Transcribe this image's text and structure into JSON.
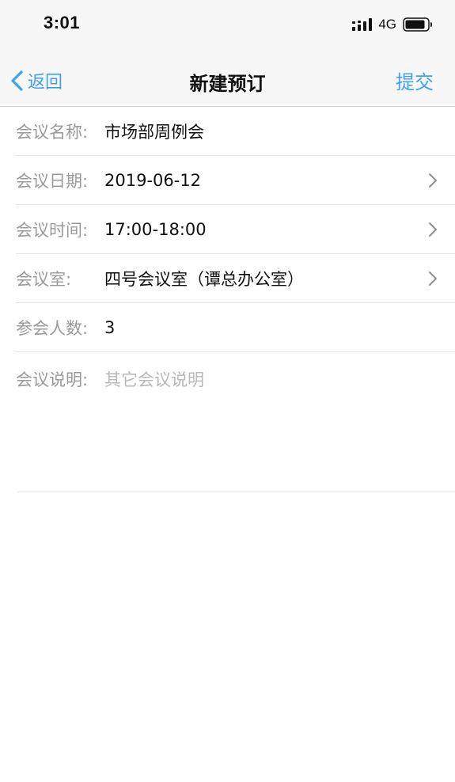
{
  "status_bar": {
    "time": "3:01",
    "network": "4G",
    "signal_icon": "signal-bars-icon",
    "battery_icon": "battery-icon"
  },
  "nav": {
    "back_label": "返回",
    "title": "新建预订",
    "submit_label": "提交",
    "accent_color": "#3fa0f0"
  },
  "form": {
    "rows": [
      {
        "label": "会议名称:",
        "value": "市场部周例会",
        "has_chevron": false
      },
      {
        "label": "会议日期:",
        "value": "2019-06-12",
        "has_chevron": true
      },
      {
        "label": "会议时间:",
        "value": "17:00-18:00",
        "has_chevron": true
      },
      {
        "label": "会议室:",
        "value": "四号会议室（谭总办公室）",
        "has_chevron": true
      },
      {
        "label": "参会人数:",
        "value": "3",
        "has_chevron": false
      }
    ],
    "description": {
      "label": "会议说明:",
      "placeholder": "其它会议说明"
    }
  }
}
